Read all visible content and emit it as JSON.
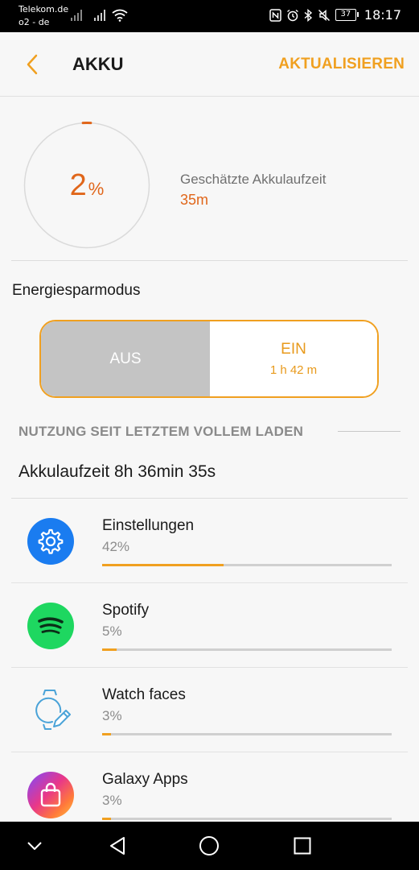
{
  "status_bar": {
    "carrier1": "Telekom.de",
    "carrier2": "o2 - de",
    "battery_level": "37",
    "time": "18:17"
  },
  "header": {
    "title": "AKKU",
    "refresh_label": "AKTUALISIEREN"
  },
  "battery": {
    "percent_value": "2",
    "percent_sign": "%",
    "level_fraction": 0.02,
    "estimate_label": "Geschätzte Akkulaufzeit",
    "estimate_value": "35m"
  },
  "power_saving": {
    "heading": "Energiesparmodus",
    "off_label": "AUS",
    "on_label": "EIN",
    "on_sublabel": "1 h 42 m",
    "selected": "off"
  },
  "usage": {
    "section_title": "NUTZUNG SEIT LETZTEM VOLLEM LADEN",
    "runtime": "Akkulaufzeit 8h 36min 35s",
    "apps": [
      {
        "name": "Einstellungen",
        "percent": "42%",
        "fraction": 0.42,
        "icon": "settings-gear-icon"
      },
      {
        "name": "Spotify",
        "percent": "5%",
        "fraction": 0.05,
        "icon": "spotify-icon"
      },
      {
        "name": "Watch faces",
        "percent": "3%",
        "fraction": 0.03,
        "icon": "watch-face-icon"
      },
      {
        "name": "Galaxy Apps",
        "percent": "3%",
        "fraction": 0.03,
        "icon": "galaxy-apps-bag-icon"
      }
    ]
  },
  "colors": {
    "accent": "#f0a020",
    "battery_orange": "#e0661a",
    "settings_blue": "#1a7cf0",
    "spotify_green": "#1ed760"
  }
}
